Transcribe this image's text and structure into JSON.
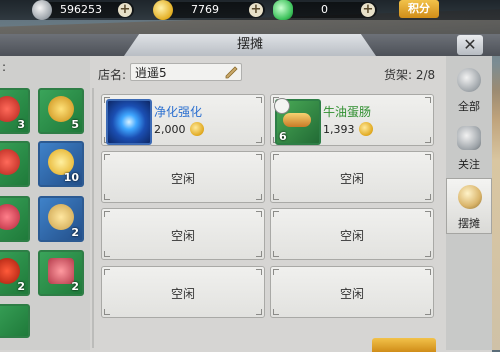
{
  "currency": {
    "silver": "596253",
    "gold": "7769",
    "jade": "0",
    "points_button": "积分"
  },
  "window": {
    "title": "摆摊",
    "close": "✕"
  },
  "shop": {
    "name_label": "店名:",
    "name_value": "逍遥5",
    "shelf_label": "货架: 2/8"
  },
  "left": {
    "label": ":",
    "items": [
      {
        "count": "3"
      },
      {
        "count": "5"
      },
      {
        "count": ""
      },
      {
        "count": "10"
      },
      {
        "count": ""
      },
      {
        "count": "2"
      },
      {
        "count": "2"
      },
      {
        "count": "2"
      }
    ]
  },
  "slots": {
    "s1": {
      "name": "净化强化",
      "price": "2,000",
      "name_color": "#2a6fd0"
    },
    "s2": {
      "name": "牛油蛋肠",
      "price": "1,393",
      "level": "6",
      "name_color": "#2f8f2f"
    },
    "empty_label": "空闲"
  },
  "tabs": {
    "all": "全部",
    "follow": "关注",
    "stall": "摆摊"
  },
  "colors": {
    "accent_gold": "#d08d18",
    "panel_bg": "#d6d5d3"
  }
}
